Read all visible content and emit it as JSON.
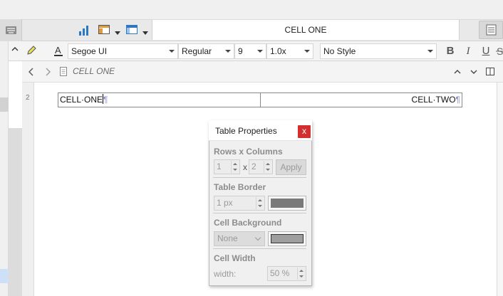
{
  "toolbar": {
    "document_title": "CELL ONE",
    "font_family": "Segoe UI",
    "font_style": "Regular",
    "font_size": "9",
    "line_spacing": "1.0x",
    "paragraph_style": "No Style",
    "bold_label": "B",
    "italic_label": "I",
    "underline_label": "U"
  },
  "nav": {
    "breadcrumb": "CELL ONE"
  },
  "editor": {
    "line_number": "2",
    "cells": [
      {
        "text": "CELL·ONE"
      },
      {
        "text": "CELL·TWO"
      }
    ],
    "pilcrow": "¶"
  },
  "dialog": {
    "title": "Table Properties",
    "close_label": "x",
    "rows_columns": {
      "label": "Rows x Columns",
      "rows": "1",
      "times": "x",
      "columns": "2",
      "apply_label": "Apply"
    },
    "table_border": {
      "label": "Table Border",
      "width": "1 px",
      "color": "#7a7a7a"
    },
    "cell_background": {
      "label": "Cell Background",
      "option": "None",
      "color": "#9e9e9e"
    },
    "cell_width": {
      "label": "Cell Width",
      "width_label": "width:",
      "value": "50 %"
    }
  },
  "colors": {
    "accent_blue": "#2b78c5",
    "close_red": "#d32f2f"
  },
  "icons": {
    "chart": "bar-chart-icon",
    "table_layout": "layout-icon",
    "panel": "panel-icon",
    "pencil": "pencil-icon",
    "text_color": "text-color-icon",
    "back": "chevron-left-icon",
    "forward": "chevron-right-icon",
    "document": "document-icon",
    "up": "chevron-up-icon",
    "down": "chevron-down-icon",
    "split_view": "split-view-icon"
  }
}
